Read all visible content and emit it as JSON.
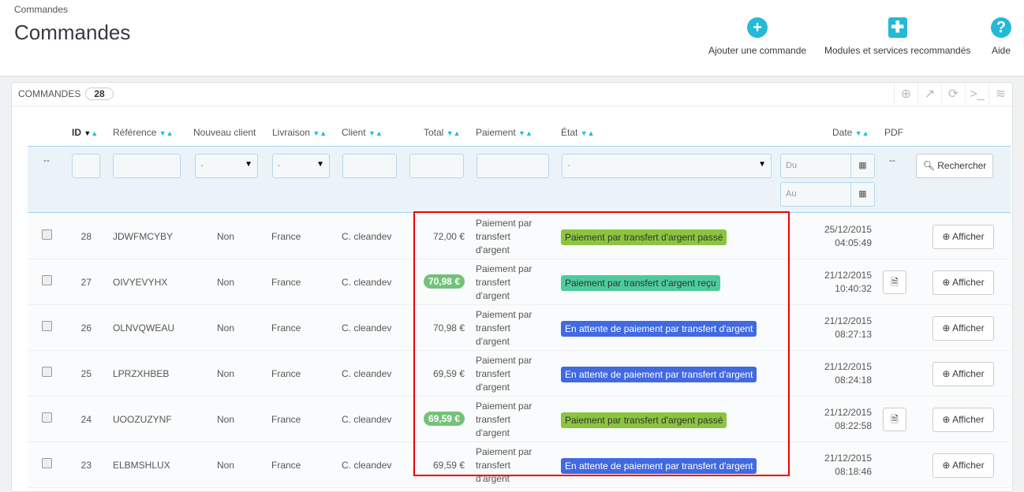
{
  "breadcrumb": "Commandes",
  "title": "Commandes",
  "toolbar": [
    {
      "label": "Ajouter une commande",
      "icon": "plus-circle-icon"
    },
    {
      "label": "Modules et services recommandés",
      "icon": "puzzle-icon"
    },
    {
      "label": "Aide",
      "icon": "help-icon"
    }
  ],
  "panel": {
    "title": "COMMANDES",
    "count": "28"
  },
  "headers": {
    "id": "ID",
    "reference": "Référence",
    "new_client": "Nouveau client",
    "delivery": "Livraison",
    "client": "Client",
    "total": "Total",
    "payment": "Paiement",
    "state": "État",
    "date": "Date",
    "pdf": "PDF"
  },
  "filters": {
    "dash": "--",
    "select_default": "-",
    "from": "Du",
    "to": "Au",
    "pdf_dash": "--",
    "search": "Rechercher"
  },
  "colors": {
    "passe": "#8bc53f",
    "recu": "#4ccc9d",
    "attente": "#4169e1",
    "total_badge": "#72c279"
  },
  "rows": [
    {
      "id": "28",
      "ref": "JDWFMCYBY",
      "new": "Non",
      "country": "France",
      "client": "C. cleandev",
      "total": "72,00 €",
      "total_badge": false,
      "payment": "Paiement par transfert d'argent",
      "state": "Paiement par transfert d'argent passé",
      "state_type": "passe",
      "date": "25/12/2015",
      "time": "04:05:49",
      "pdf": false,
      "action": "Afficher"
    },
    {
      "id": "27",
      "ref": "OIVYEVYHX",
      "new": "Non",
      "country": "France",
      "client": "C. cleandev",
      "total": "70,98 €",
      "total_badge": true,
      "payment": "Paiement par transfert d'argent",
      "state": "Paiement par transfert d'argent reçu",
      "state_type": "recu",
      "date": "21/12/2015",
      "time": "10:40:32",
      "pdf": true,
      "action": "Afficher"
    },
    {
      "id": "26",
      "ref": "OLNVQWEAU",
      "new": "Non",
      "country": "France",
      "client": "C. cleandev",
      "total": "70,98 €",
      "total_badge": false,
      "payment": "Paiement par transfert d'argent",
      "state": "En attente de paiement par transfert d'argent",
      "state_type": "attente",
      "date": "21/12/2015",
      "time": "08:27:13",
      "pdf": false,
      "action": "Afficher"
    },
    {
      "id": "25",
      "ref": "LPRZXHBEB",
      "new": "Non",
      "country": "France",
      "client": "C. cleandev",
      "total": "69,59 €",
      "total_badge": false,
      "payment": "Paiement par transfert d'argent",
      "state": "En attente de paiement par transfert d'argent",
      "state_type": "attente",
      "date": "21/12/2015",
      "time": "08:24:18",
      "pdf": false,
      "action": "Afficher"
    },
    {
      "id": "24",
      "ref": "UOOZUZYNF",
      "new": "Non",
      "country": "France",
      "client": "C. cleandev",
      "total": "69,59 €",
      "total_badge": true,
      "payment": "Paiement par transfert d'argent",
      "state": "Paiement par transfert d'argent passé",
      "state_type": "passe",
      "date": "21/12/2015",
      "time": "08:22:58",
      "pdf": true,
      "action": "Afficher"
    },
    {
      "id": "23",
      "ref": "ELBMSHLUX",
      "new": "Non",
      "country": "France",
      "client": "C. cleandev",
      "total": "69,59 €",
      "total_badge": false,
      "payment": "Paiement par transfert d'argent",
      "state": "En attente de paiement par transfert d'argent",
      "state_type": "attente",
      "date": "21/12/2015",
      "time": "08:18:46",
      "pdf": false,
      "action": "Afficher"
    }
  ]
}
